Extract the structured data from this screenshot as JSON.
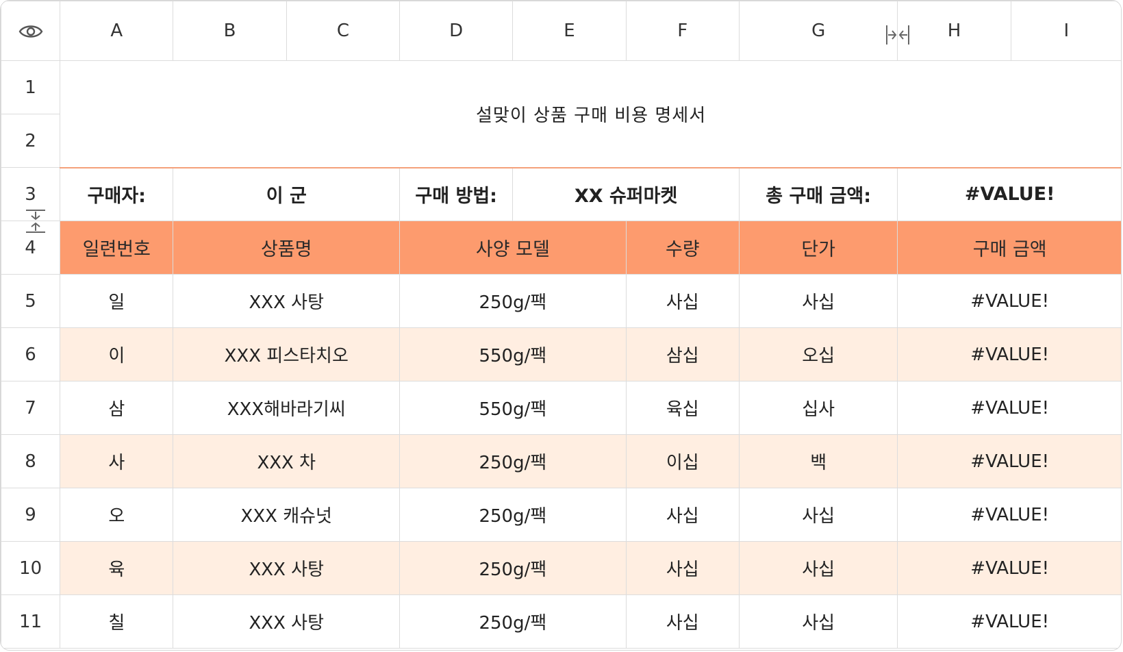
{
  "columns": [
    "A",
    "B",
    "C",
    "D",
    "E",
    "F",
    "G",
    "H",
    "I"
  ],
  "rows": [
    "1",
    "2",
    "3",
    "4",
    "5",
    "6",
    "7",
    "8",
    "9",
    "10",
    "11"
  ],
  "title": "설맞이 상품 구매 비용 명세서",
  "info": {
    "buyer_label": "구매자:",
    "buyer_value": "이 군",
    "method_label": "구매 방법:",
    "method_value": "XX 슈퍼마켓",
    "total_label": "총 구매 금액:",
    "total_value": "#VALUE!"
  },
  "headers": [
    "일련번호",
    "상품명",
    "사양 모델",
    "수량",
    "단가",
    "구매 금액"
  ],
  "items": [
    {
      "no": "일",
      "name": "XXX 사탕",
      "spec": "250g/팩",
      "qty": "사십",
      "price": "사십",
      "amount": "#VALUE!"
    },
    {
      "no": "이",
      "name": "XXX 피스타치오",
      "spec": "550g/팩",
      "qty": "삼십",
      "price": "오십",
      "amount": "#VALUE!"
    },
    {
      "no": "삼",
      "name": "XXX해바라기씨",
      "spec": "550g/팩",
      "qty": "육십",
      "price": "십사",
      "amount": "#VALUE!"
    },
    {
      "no": "사",
      "name": "XXX 차",
      "spec": "250g/팩",
      "qty": "이십",
      "price": "백",
      "amount": "#VALUE!"
    },
    {
      "no": "오",
      "name": "XXX 캐슈넛",
      "spec": "250g/팩",
      "qty": "사십",
      "price": "사십",
      "amount": "#VALUE!"
    },
    {
      "no": "육",
      "name": "XXX 사탕",
      "spec": "250g/팩",
      "qty": "사십",
      "price": "사십",
      "amount": "#VALUE!"
    },
    {
      "no": "칠",
      "name": "XXX 사탕",
      "spec": "250g/팩",
      "qty": "사십",
      "price": "사십",
      "amount": "#VALUE!"
    }
  ],
  "colors": {
    "header_fill": "#fd9b6e",
    "alt_row_fill": "#ffeee1",
    "title_border": "#f4a07a"
  },
  "icons": {
    "corner": "eye-icon",
    "column_resize": "column-resize-icon",
    "row_resize": "row-resize-icon"
  }
}
